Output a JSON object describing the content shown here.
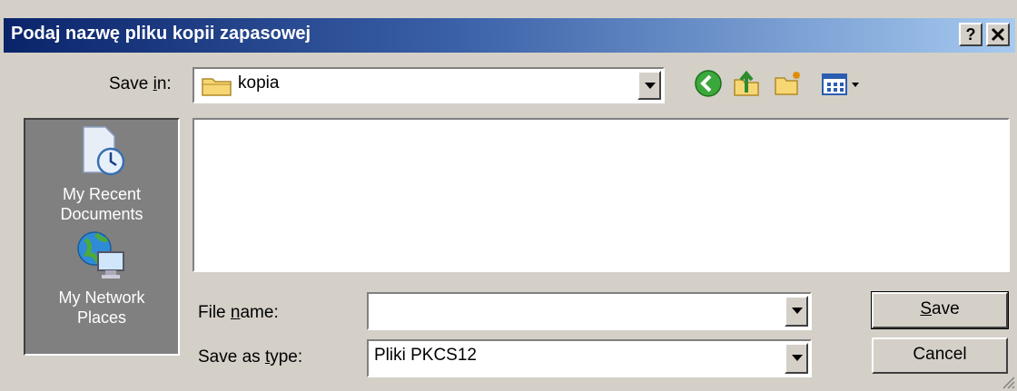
{
  "title": "Podaj nazwę pliku kopii zapasowej",
  "title_buttons": {
    "help": "?",
    "close": "✕"
  },
  "save_in": {
    "label_prefix": "Save ",
    "label_accel": "i",
    "label_suffix": "n:",
    "value": "kopia"
  },
  "toolbar": [
    "back-icon",
    "up-folder-icon",
    "new-folder-icon",
    "views-menu-icon"
  ],
  "places": [
    {
      "label1": "My Recent",
      "label2": "Documents",
      "icon": "recent-documents-icon"
    },
    {
      "label1": "My Network",
      "label2": "Places",
      "icon": "network-places-icon"
    }
  ],
  "file_name": {
    "label_prefix": "File ",
    "label_accel": "n",
    "label_suffix": "ame:",
    "value": ""
  },
  "save_as_type": {
    "label_prefix": "Save as ",
    "label_accel": "t",
    "label_suffix": "ype:",
    "value": "Pliki PKCS12"
  },
  "buttons": {
    "save_accel": "S",
    "save_rest": "ave",
    "cancel": "Cancel"
  },
  "colors": {
    "titlebar_start": "#0a246a",
    "titlebar_end": "#a6caf0",
    "face": "#d4d0c8",
    "places_bg": "#808080"
  }
}
